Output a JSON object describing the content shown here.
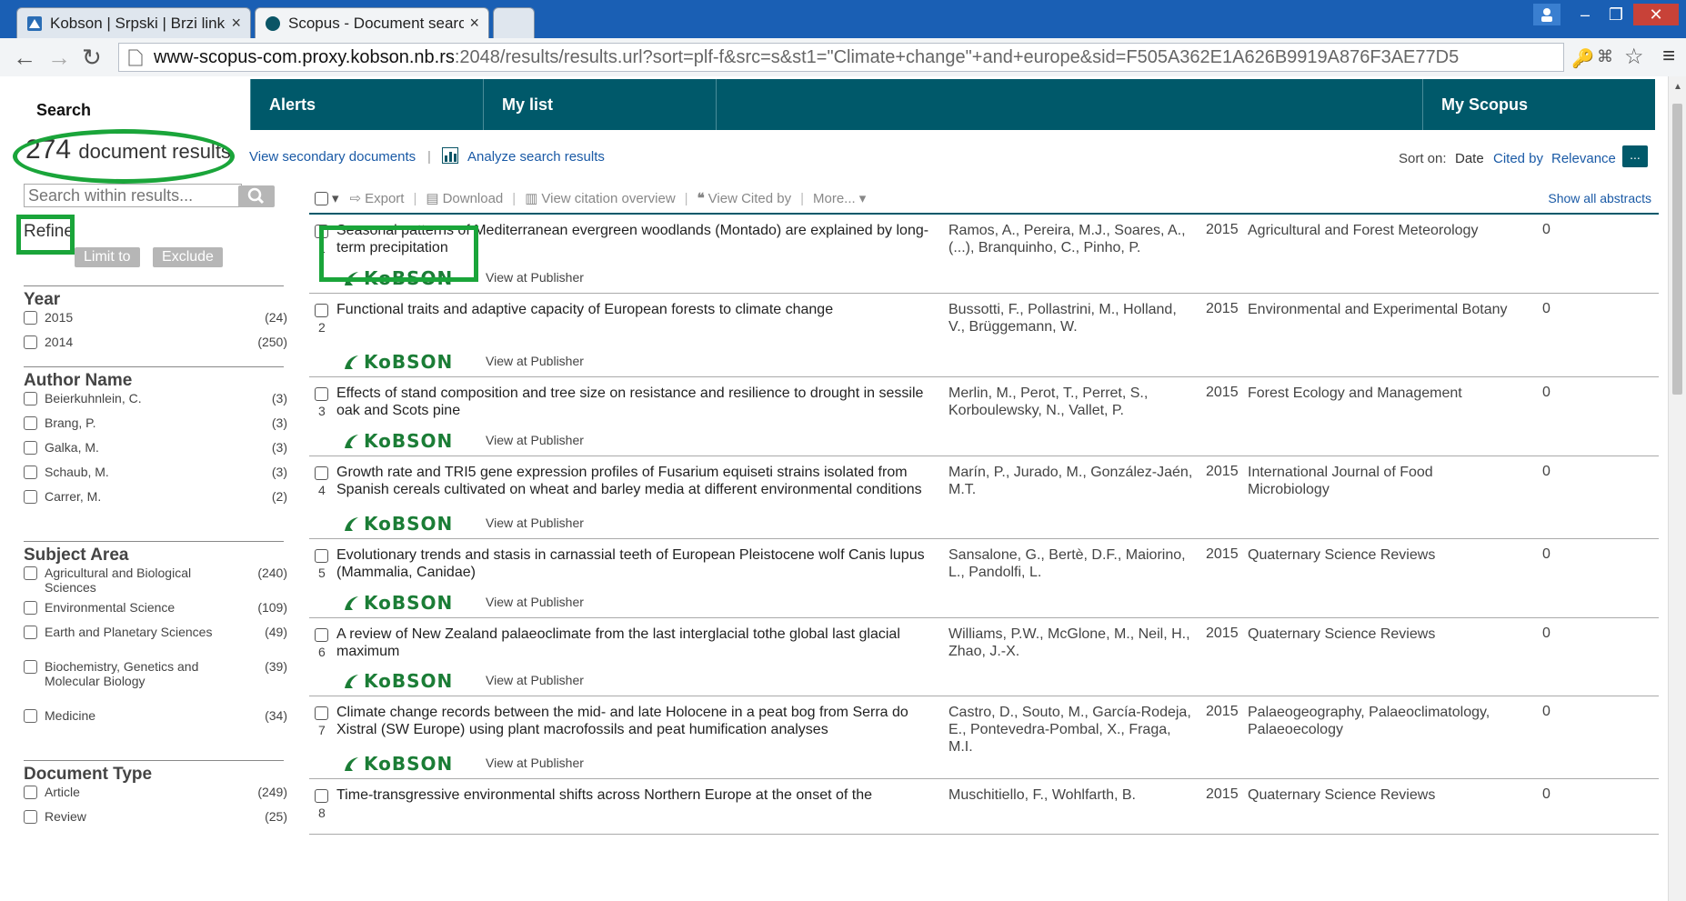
{
  "browser": {
    "tabs": [
      {
        "label": "Kobson | Srpski | Brzi linkovi",
        "active": false
      },
      {
        "label": "Scopus - Document search results",
        "active": true
      }
    ],
    "url_host": "www-scopus-com.proxy.kobson.nb.rs",
    "url_rest": ":2048/results/results.url?sort=plf-f&src=s&st1=\"Climate+change\"+and+europe&sid=F505A362E1A626B9919A876F3AE77D5"
  },
  "nav": {
    "search": "Search",
    "alerts": "Alerts",
    "my_list": "My list",
    "my_scopus": "My Scopus"
  },
  "summary": {
    "count": "274",
    "count_word": "document results",
    "view_secondary": "View secondary documents",
    "separator": "|",
    "analyze": "Analyze search results",
    "sort_on": "Sort on:",
    "sort_date": "Date",
    "sort_cited": "Cited by",
    "sort_relevance": "Relevance",
    "sort_more": "..."
  },
  "sidebar": {
    "search_placeholder": "Search within results...",
    "refine": "Refine",
    "limit_to": "Limit to",
    "exclude": "Exclude",
    "year": {
      "heading": "Year",
      "items": [
        {
          "name": "2015",
          "count": "(24)"
        },
        {
          "name": "2014",
          "count": "(250)"
        }
      ]
    },
    "author": {
      "heading": "Author Name",
      "items": [
        {
          "name": "Beierkuhnlein, C.",
          "count": "(3)"
        },
        {
          "name": "Brang, P.",
          "count": "(3)"
        },
        {
          "name": "Galka, M.",
          "count": "(3)"
        },
        {
          "name": "Schaub, M.",
          "count": "(3)"
        },
        {
          "name": "Carrer, M.",
          "count": "(2)"
        }
      ]
    },
    "subject": {
      "heading": "Subject Area",
      "items": [
        {
          "name": "Agricultural and Biological Sciences",
          "count": "(240)"
        },
        {
          "name": "Environmental Science",
          "count": "(109)"
        },
        {
          "name": "Earth and Planetary Sciences",
          "count": "(49)"
        },
        {
          "name": "Biochemistry, Genetics and Molecular Biology",
          "count": "(39)"
        },
        {
          "name": "Medicine",
          "count": "(34)"
        }
      ]
    },
    "doctype": {
      "heading": "Document Type",
      "items": [
        {
          "name": "Article",
          "count": "(249)"
        },
        {
          "name": "Review",
          "count": "(25)"
        }
      ]
    }
  },
  "actions": {
    "export": "Export",
    "download": "Download",
    "citation_overview": "View citation overview",
    "view_cited": "View Cited by",
    "more": "More...",
    "show_abstracts": "Show all abstracts"
  },
  "results_common": {
    "kobson": "KoBSON",
    "view_publisher": "View at Publisher"
  },
  "results": [
    {
      "num": "1",
      "title": "Seasonal patterns of Mediterranean evergreen woodlands (Montado) are explained by long-term precipitation",
      "authors": "Ramos, A., Pereira, M.J., Soares, A., (...), Branquinho, C., Pinho, P.",
      "year": "2015",
      "source": "Agricultural and Forest Meteorology",
      "cited": "0"
    },
    {
      "num": "2",
      "title": "Functional traits and adaptive capacity of European forests to climate change",
      "authors": "Bussotti, F., Pollastrini, M., Holland, V., Brüggemann, W.",
      "year": "2015",
      "source": "Environmental and Experimental Botany",
      "cited": "0"
    },
    {
      "num": "3",
      "title": "Effects of stand composition and tree size on resistance and resilience to drought in sessile oak and Scots pine",
      "authors": "Merlin, M., Perot, T., Perret, S., Korboulewsky, N., Vallet, P.",
      "year": "2015",
      "source": "Forest Ecology and Management",
      "cited": "0"
    },
    {
      "num": "4",
      "title": "Growth rate and TRI5 gene expression profiles of Fusarium equiseti strains isolated from Spanish cereals cultivated on wheat and barley media at different environmental conditions",
      "authors": "Marín, P., Jurado, M., González-Jaén, M.T.",
      "year": "2015",
      "source": "International Journal of Food Microbiology",
      "cited": "0"
    },
    {
      "num": "5",
      "title": "Evolutionary trends and stasis in carnassial teeth of European Pleistocene wolf Canis lupus (Mammalia, Canidae)",
      "authors": "Sansalone, G., Bertè, D.F., Maiorino, L., Pandolfi, L.",
      "year": "2015",
      "source": "Quaternary Science Reviews",
      "cited": "0"
    },
    {
      "num": "6",
      "title": "A review of New Zealand palaeoclimate from the last interglacial tothe global last glacial maximum",
      "authors": "Williams, P.W., McGlone, M., Neil, H., Zhao, J.-X.",
      "year": "2015",
      "source": "Quaternary Science Reviews",
      "cited": "0"
    },
    {
      "num": "7",
      "title": "Climate change records between the mid- and late Holocene in a peat bog from Serra do Xistral (SW Europe) using plant macrofossils and peat humification analyses",
      "authors": "Castro, D., Souto, M., García-Rodeja, E., Pontevedra-Pombal, X., Fraga, M.I.",
      "year": "2015",
      "source": "Palaeogeography, Palaeoclimatology, Palaeoecology",
      "cited": "0"
    },
    {
      "num": "8",
      "title": "Time-transgressive environmental shifts across Northern Europe at the onset of the",
      "authors": "Muschitiello, F., Wohlfarth, B.",
      "year": "2015",
      "source": "Quaternary Science Reviews",
      "cited": "0"
    }
  ]
}
